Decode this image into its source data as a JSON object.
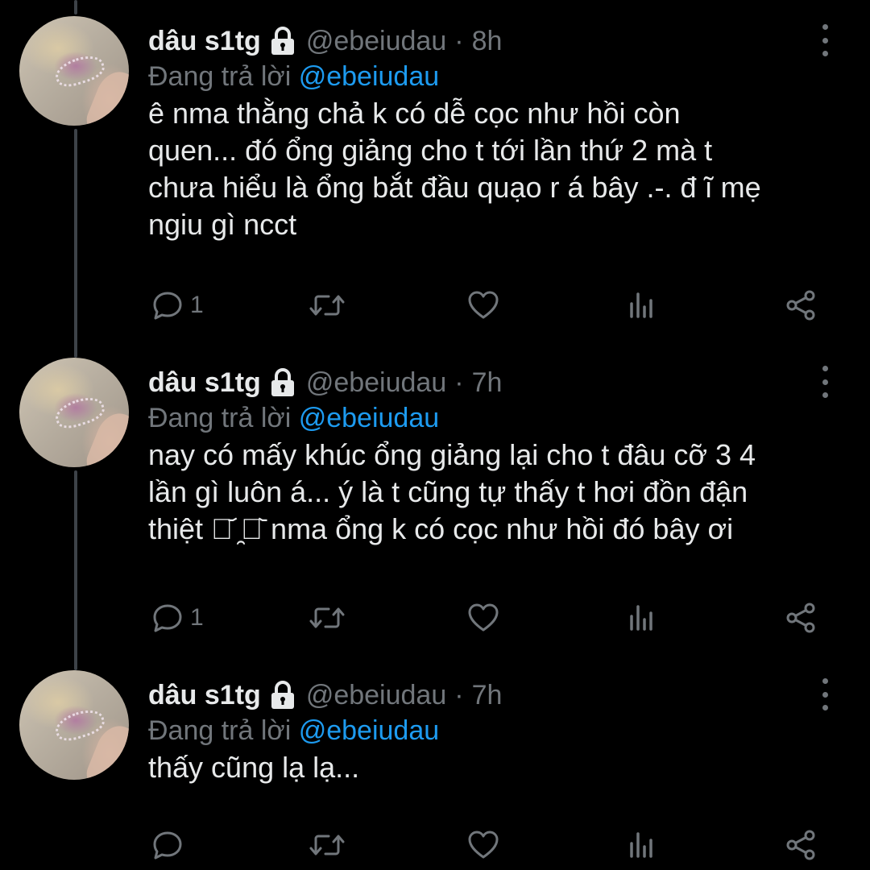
{
  "tweets": [
    {
      "author_name": "dâu s1tg",
      "handle": "@ebeiudau",
      "separator": "·",
      "time": "8h",
      "replying_prefix": "Đang trả lời",
      "replying_to": "@ebeiudau",
      "text": "ê nma thằng chả k có dễ cọc như hồi còn\nquen... đó ổng giảng cho t tới lần thứ 2 mà t\nchưa hiểu là ổng bắt đầu quạo r á bây .-. đ ĩ mẹ\nngiu gì ncct",
      "reply_count": "1"
    },
    {
      "author_name": "dâu s1tg",
      "handle": "@ebeiudau",
      "separator": "·",
      "time": "7h",
      "replying_prefix": "Đang trả lời",
      "replying_to": "@ebeiudau",
      "text": "nay có mấy khúc ổng giảng lại cho t đâu cỡ 3 4\nlần gì luôn á... ý là t cũng tự thấy t hơi đồn đận\nthiệt ꈍ᷄ ̯ꈍ᷅ nma ổng k có cọc như hồi đó bây ơi",
      "reply_count": "1"
    },
    {
      "author_name": "dâu s1tg",
      "handle": "@ebeiudau",
      "separator": "·",
      "time": "7h",
      "replying_prefix": "Đang trả lời",
      "replying_to": "@ebeiudau",
      "text": "thấy cũng lạ lạ...",
      "reply_count": ""
    }
  ],
  "icons": {
    "lock": "lock-icon",
    "more": "more-vertical-icon",
    "reply": "reply-bubble-icon",
    "retweet": "retweet-icon",
    "like": "heart-icon",
    "views": "analytics-icon",
    "share": "share-icon"
  },
  "colors": {
    "background": "#000000",
    "text": "#e7e9ea",
    "secondary": "#71767b",
    "link": "#1d9bf0",
    "thread_line": "#3d4248"
  }
}
